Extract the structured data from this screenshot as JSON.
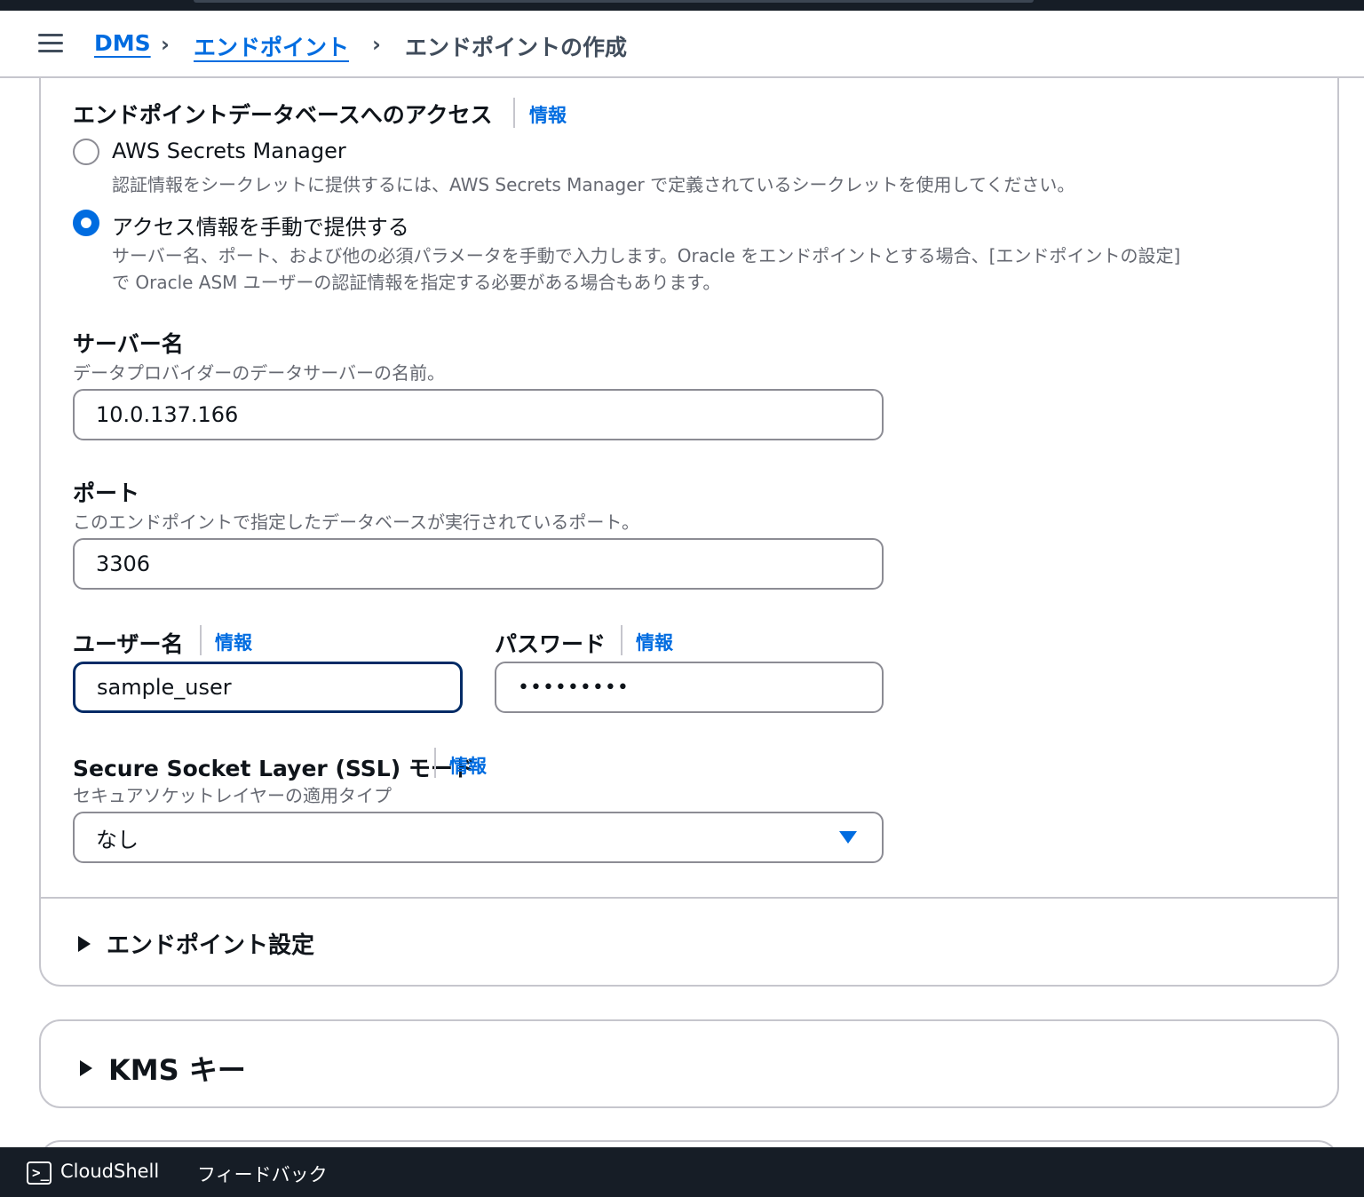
{
  "breadcrumb": {
    "items": [
      "DMS",
      "エンドポイント"
    ],
    "current": "エンドポイントの作成"
  },
  "access": {
    "heading": "エンドポイントデータベースへのアクセス",
    "info": "情報",
    "options": [
      {
        "label": "AWS Secrets Manager",
        "description": "認証情報をシークレットに提供するには、AWS Secrets Manager で定義されているシークレットを使用してください。",
        "checked": false
      },
      {
        "label": "アクセス情報を手動で提供する",
        "description_line1": "サーバー名、ポート、および他の必須パラメータを手動で入力します。Oracle をエンドポイントとする場合、[エンドポイントの設定]",
        "description_line2": "で Oracle ASM ユーザーの認証情報を指定する必要がある場合もあります。",
        "checked": true
      }
    ]
  },
  "server": {
    "label": "サーバー名",
    "description": "データプロバイダーのデータサーバーの名前。",
    "value": "10.0.137.166"
  },
  "port": {
    "label": "ポート",
    "description": "このエンドポイントで指定したデータベースが実行されているポート。",
    "value": "3306"
  },
  "username": {
    "label": "ユーザー名",
    "info": "情報",
    "value": "sample_user"
  },
  "password": {
    "label": "パスワード",
    "info": "情報",
    "value": "•••••••••"
  },
  "ssl": {
    "label": "Secure Socket Layer (SSL) モード",
    "info": "情報",
    "description": "セキュアソケットレイヤーの適用タイプ",
    "value": "なし"
  },
  "endpoint_settings": {
    "label": "エンドポイント設定"
  },
  "kms": {
    "label": "KMS キー"
  },
  "footer": {
    "cloudshell": "CloudShell",
    "feedback": "フィードバック"
  },
  "colors": {
    "link": "#006ce0",
    "focus": "#002b66",
    "dark_bar": "#161d26"
  }
}
